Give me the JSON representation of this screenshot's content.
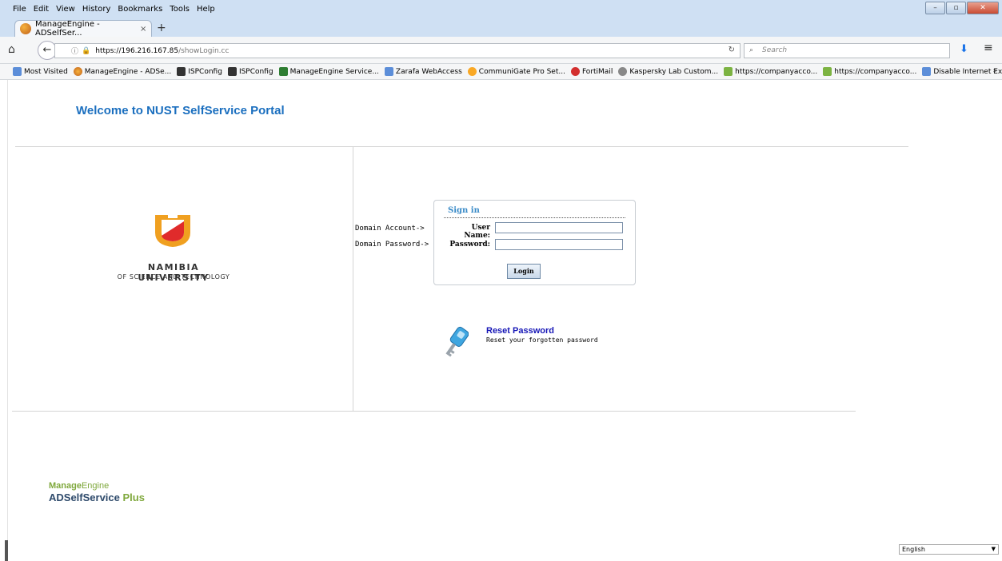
{
  "menu": [
    "File",
    "Edit",
    "View",
    "History",
    "Bookmarks",
    "Tools",
    "Help"
  ],
  "tab": {
    "title": "ManageEngine - ADSelfSer...",
    "close": "×",
    "new": "+"
  },
  "nav": {
    "url_host": "https://196.216.167.85",
    "url_path": "/showLogin.cc",
    "search_placeholder": "Search"
  },
  "bookmarks": [
    "Most Visited",
    "ManageEngine - ADSe...",
    "ISPConfig",
    "ISPConfig",
    "ManageEngine Service...",
    "Zarafa WebAccess",
    "CommuniGate Pro Set...",
    "FortiMail",
    "Kaspersky Lab Custom...",
    "https://companyacco...",
    "https://companyacco...",
    "Disable Internet Explor..."
  ],
  "page": {
    "welcome": "Welcome to NUST SelfService Portal",
    "university_line1": "NAMIBIA UNIVERSITY",
    "university_line2": "OF SCIENCE AND TECHNOLOGY",
    "domain_account_hint": "Domain Account->",
    "domain_password_hint": "Domain Password->",
    "signin": {
      "title": "Sign in",
      "user_label": "User Name:",
      "user_value": "",
      "password_label": "Password:",
      "password_value": "",
      "login_button": "Login"
    },
    "reset": {
      "title": "Reset Password",
      "subtitle": "Reset your forgotten password"
    },
    "footer": {
      "brand_bold": "Manage",
      "brand_light": "Engine",
      "product": "ADSelfService",
      "product_plus": "Plus",
      "language": "English"
    }
  },
  "colors": {
    "title_blue": "#1b6fbf",
    "signin_blue": "#3a8bc8",
    "link_blue": "#1515b6",
    "nust_orange": "#f0a020",
    "nust_red": "#e02b2b"
  }
}
